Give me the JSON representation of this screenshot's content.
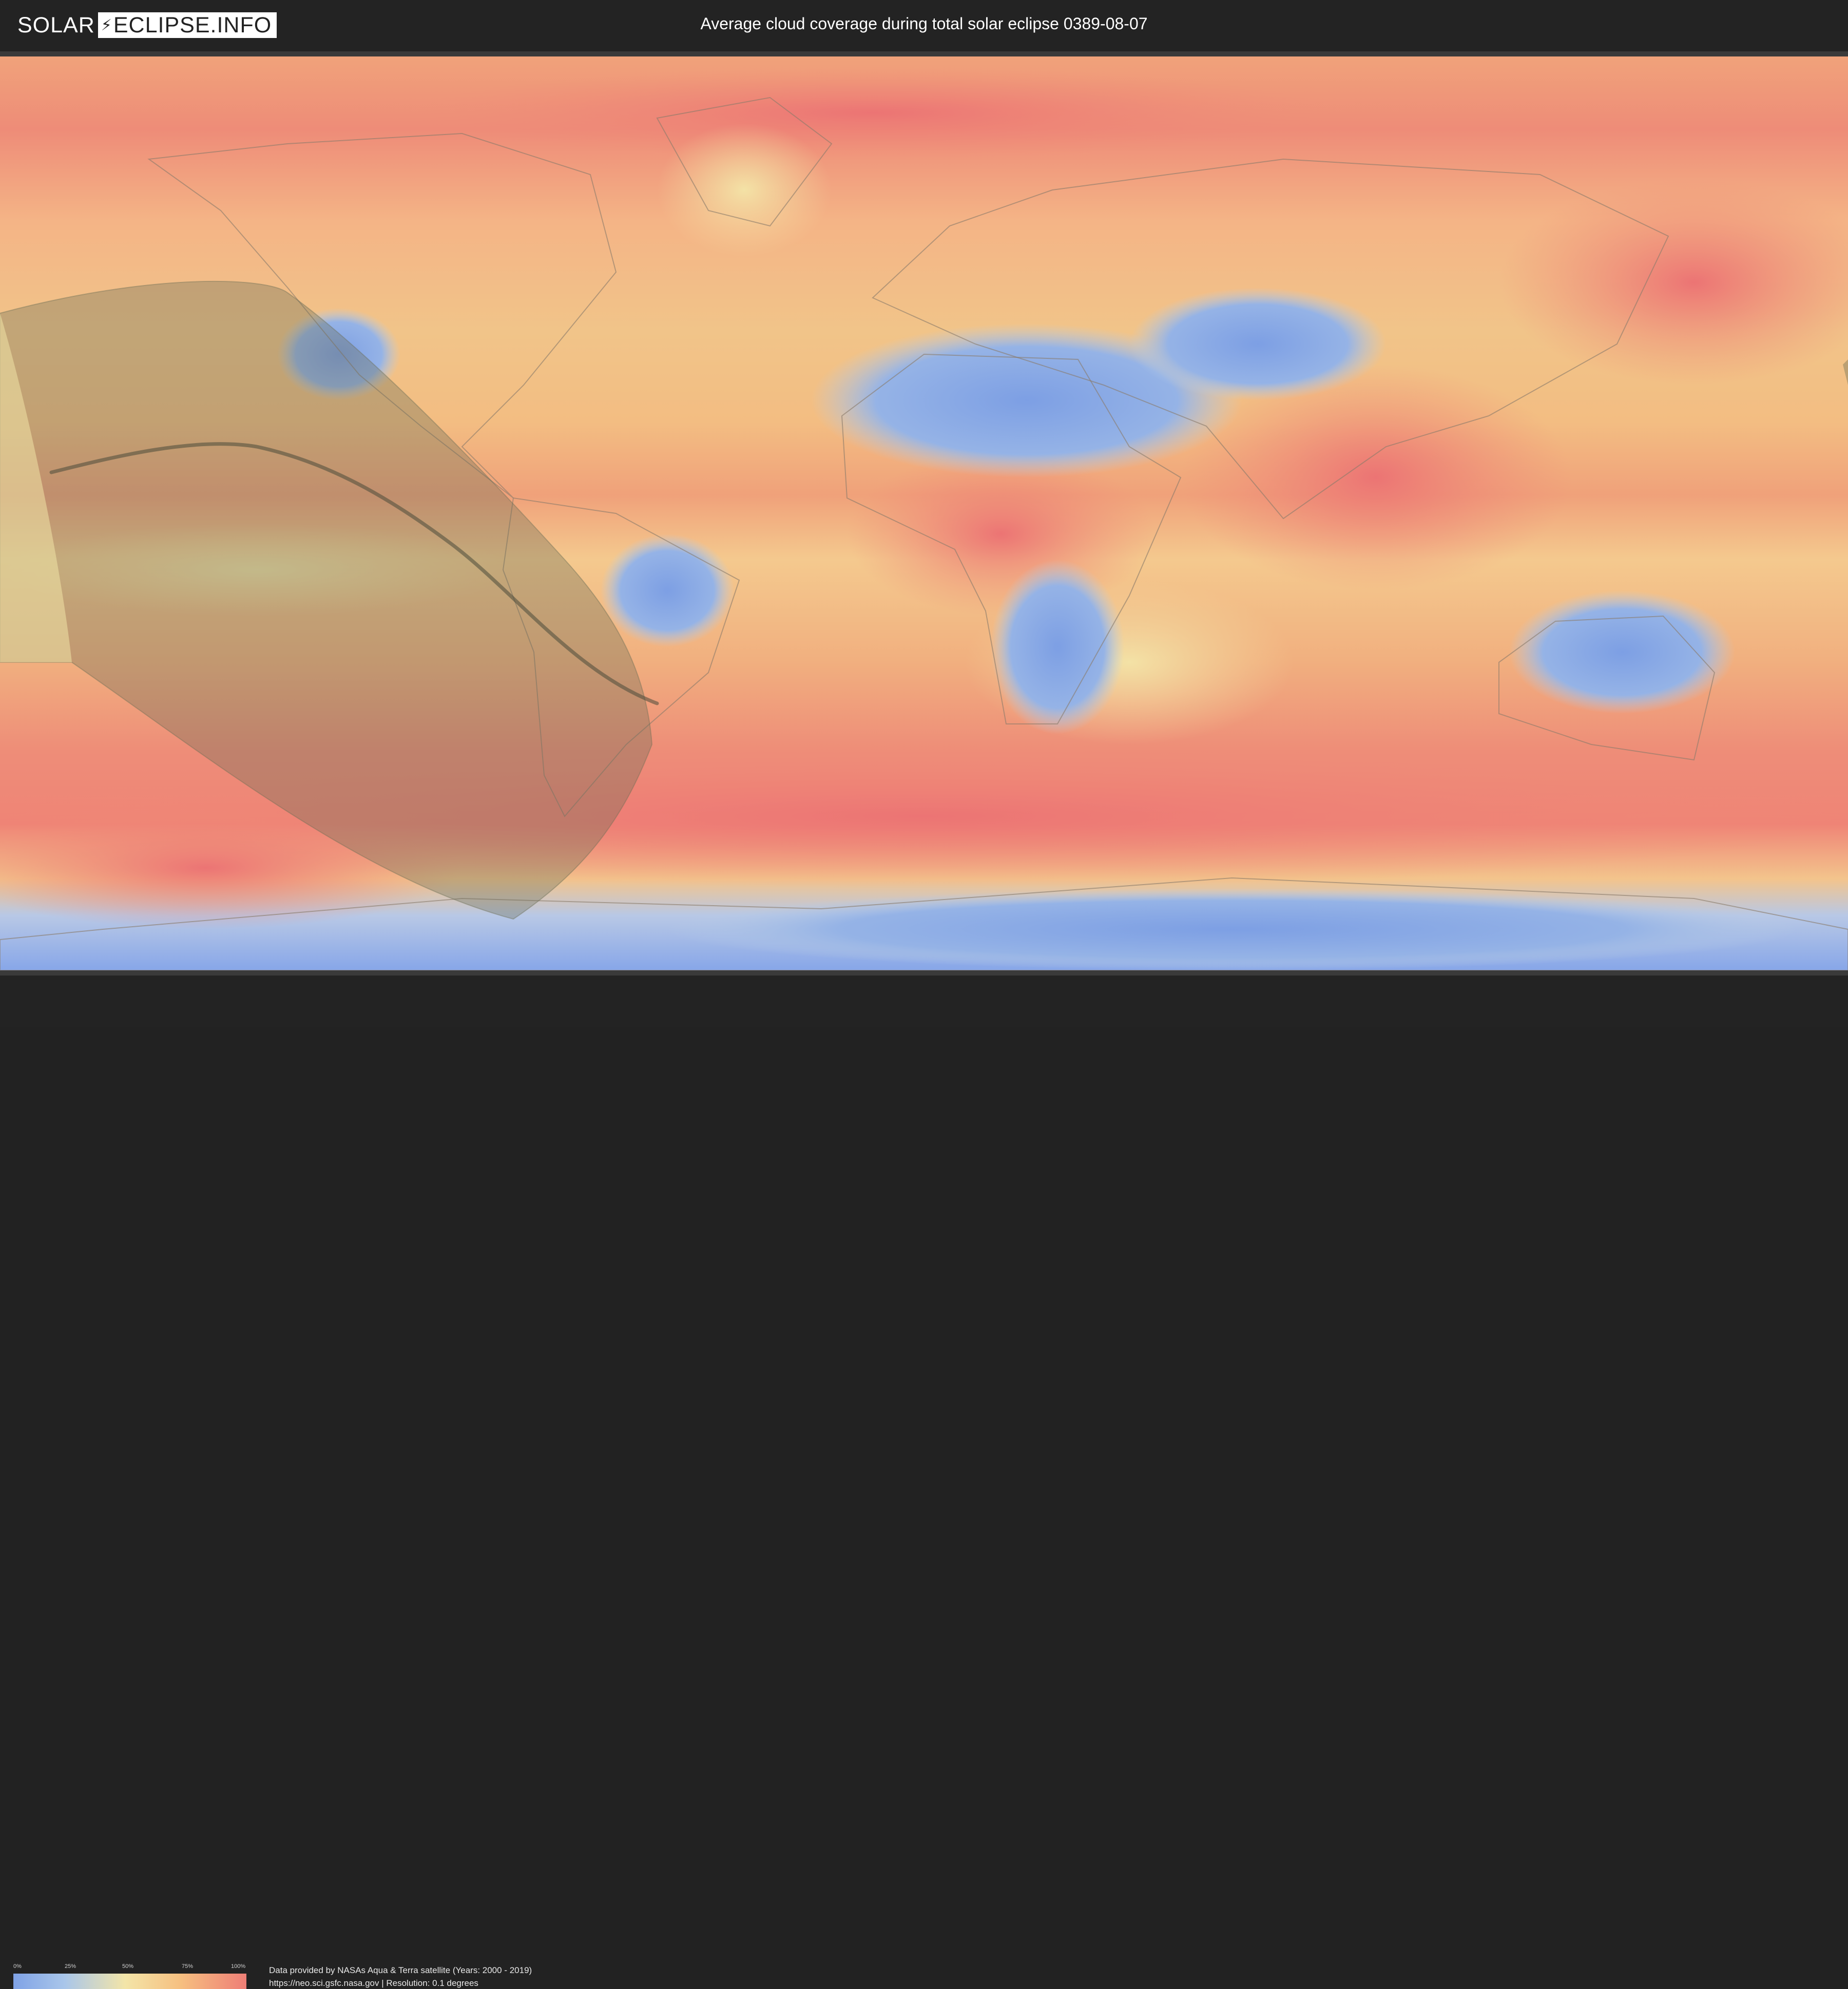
{
  "header": {
    "logo_solar": "SOLAR",
    "logo_eclipse": "ECLIPSE.INFO",
    "title": "Average cloud coverage during total solar eclipse 0389-08-07"
  },
  "map": {
    "description_icon": "world-map",
    "colors": {
      "clear": "#7fa2e6",
      "light": "#a9c6ea",
      "medium": "#f3e5a8",
      "cloudy": "#f6bf80",
      "overcast": "#ee7e76",
      "eclipse_shadow": "#6b6e55",
      "eclipse_path": "#4a4a3a"
    }
  },
  "legend": {
    "ticks": [
      "0%",
      "25%",
      "50%",
      "75%",
      "100%"
    ],
    "values": [
      0,
      0.25,
      0.5,
      0.75,
      1.0
    ]
  },
  "footer": {
    "line1": "Data provided by NASAs Aqua & Terra satellite (Years: 2000 - 2019)",
    "line2": "https://neo.sci.gsfc.nasa.gov | Resolution: 0.1 degrees"
  }
}
